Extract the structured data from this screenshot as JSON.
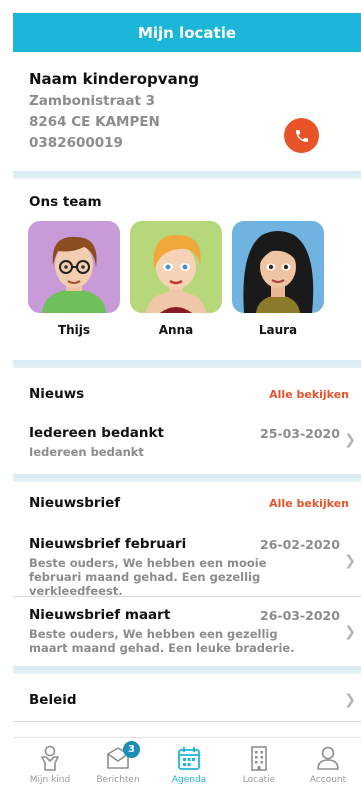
{
  "header": {
    "title": "Mijn locatie"
  },
  "location": {
    "name": "Naam kinderopvang",
    "street": "Zambonistraat 3",
    "city": "8264 CE KAMPEN",
    "phone": "0382600019"
  },
  "team": {
    "title": "Ons team",
    "members": [
      {
        "name": "Thijs"
      },
      {
        "name": "Anna"
      },
      {
        "name": "Laura"
      }
    ]
  },
  "news": {
    "title": "Nieuws",
    "see_all": "Alle bekijken",
    "items": [
      {
        "title": "Iedereen bedankt",
        "date": "25-03-2020",
        "excerpt": "Iedereen bedankt"
      }
    ]
  },
  "newsletter": {
    "title": "Nieuwsbrief",
    "see_all": "Alle bekijken",
    "items": [
      {
        "title": "Nieuwsbrief februari",
        "date": "26-02-2020",
        "excerpt": "Beste ouders,  We hebben een mooie februari maand gehad. Een gezellig verkleedfeest."
      },
      {
        "title": "Nieuwsbrief maart",
        "date": "26-03-2020",
        "excerpt": "Beste ouders,  We hebben een gezellig maart maand gehad. Een leuke braderie."
      }
    ]
  },
  "policy": {
    "title": "Beleid"
  },
  "tabbar": {
    "tabs": [
      {
        "label": "Mijn kind",
        "icon": "child-icon"
      },
      {
        "label": "Berichten",
        "icon": "messages-icon",
        "badge": "3"
      },
      {
        "label": "Agenda",
        "icon": "calendar-icon",
        "active": true
      },
      {
        "label": "Locatie",
        "icon": "building-icon"
      },
      {
        "label": "Account",
        "icon": "user-icon"
      }
    ]
  },
  "colors": {
    "accent": "#1cb6d8",
    "action": "#e8532a",
    "muted": "#8c8c8c"
  }
}
